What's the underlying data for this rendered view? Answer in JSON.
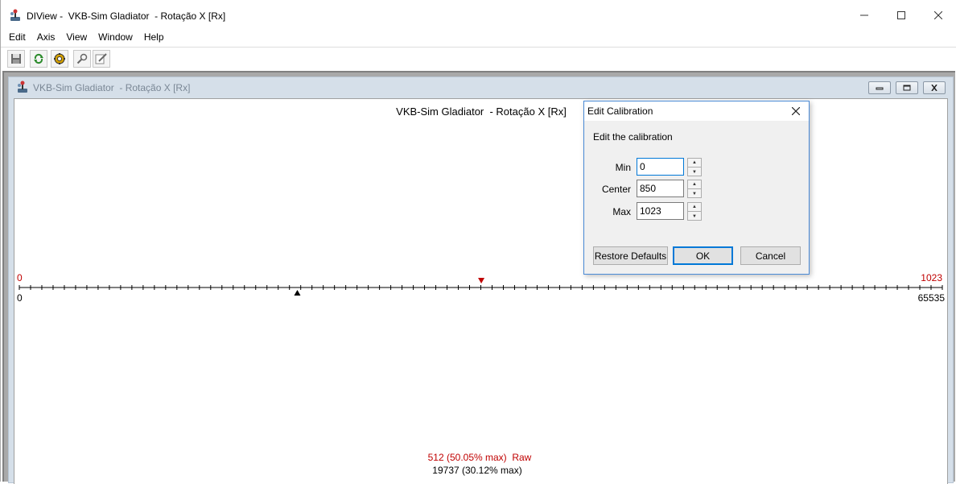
{
  "window": {
    "title": "DIView -  VKB-Sim Gladiator  - Rotação X [Rx]"
  },
  "menu": [
    "Edit",
    "Axis",
    "View",
    "Window",
    "Help"
  ],
  "toolbar": {
    "icons": [
      "save-icon",
      "refresh-icon",
      "settings-icon",
      "search-icon",
      "edit-icon"
    ]
  },
  "child_window": {
    "title": "VKB-Sim Gladiator  - Rotação X [Rx]"
  },
  "axis_view": {
    "title": "VKB-Sim Gladiator  - Rotação X [Rx]",
    "calibrated_min_label": "0",
    "calibrated_max_label": "1023",
    "raw_min_label": "0",
    "raw_max_label": "65535",
    "calibrated_readout": "512 (50.05% max)  Raw",
    "raw_readout": "19737 (30.12% max)",
    "calibrated_value_fraction": 0.5005,
    "raw_value_fraction": 0.3012,
    "colors": {
      "calibrated": "#c00000",
      "raw": "#000000"
    }
  },
  "dialog": {
    "title": "Edit Calibration",
    "subtitle": "Edit the calibration",
    "fields": [
      {
        "label": "Min",
        "value": "0"
      },
      {
        "label": "Center",
        "value": "850"
      },
      {
        "label": "Max",
        "value": "1023"
      }
    ],
    "buttons": {
      "restore": "Restore Defaults",
      "ok": "OK",
      "cancel": "Cancel"
    }
  }
}
